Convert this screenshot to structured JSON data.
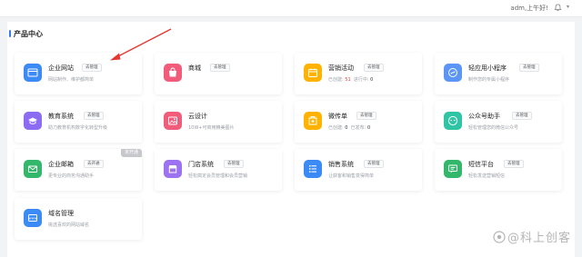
{
  "header": {
    "greeting": "adm,上午好!"
  },
  "section": {
    "title": "产品中心"
  },
  "cards": [
    {
      "title": "企业网站",
      "action": "去管理",
      "desc": "网站制作、维护都简单",
      "color": "#3b8af5",
      "icon": "browser-icon"
    },
    {
      "title": "商城",
      "action": "去管理",
      "desc": "",
      "color": "#f25c7b",
      "icon": "shopping-bag-icon"
    },
    {
      "title": "营销活动",
      "action": "去管理",
      "stats": {
        "l1": "已创建:",
        "v1": "51",
        "l2": "进行中:",
        "v2": "0"
      },
      "color": "#ffb300",
      "icon": "calendar-icon"
    },
    {
      "title": "轻应用小程序",
      "action": "去管理",
      "desc": "制作您的专属小程序",
      "color": "#5b95f7",
      "icon": "mini-program-icon"
    },
    {
      "title": "教育系统",
      "action": "去管理",
      "desc": "助力教育机构数字化转型升级",
      "color": "#8c6cf2",
      "icon": "education-icon"
    },
    {
      "title": "云设计",
      "action": "",
      "desc": "10W+可商用精美图片",
      "color": "#f25c7b",
      "icon": "image-icon"
    },
    {
      "title": "微传单",
      "action": "去管理",
      "stats": {
        "l1": "已创建:",
        "v1": "0",
        "l2": "已发布:",
        "v2": "0"
      },
      "color": "#ffb300",
      "icon": "flyer-icon"
    },
    {
      "title": "公众号助手",
      "action": "去管理",
      "desc": "轻松管理您的微信公众号",
      "color": "#2ec4a4",
      "icon": "wechat-icon"
    },
    {
      "title": "企业邮箱",
      "action": "去开通",
      "desc": "更专业的商务沟通助手",
      "color": "#33b86b",
      "icon": "mail-icon",
      "badge": "未开通"
    },
    {
      "title": "门店系统",
      "action": "去管理",
      "desc": "轻松搞定会员管理和会员营销",
      "color": "#9c72f0",
      "icon": "store-icon"
    },
    {
      "title": "销售系统",
      "action": "去管理",
      "desc": "让获客和销售变得简单",
      "color": "#3b8af5",
      "icon": "list-icon"
    },
    {
      "title": "短信平台",
      "action": "去管理",
      "desc": "轻松发送营销短信",
      "color": "#33b86b",
      "icon": "message-icon"
    },
    {
      "title": "域名管理",
      "action": "",
      "desc": "挑选喜欢的网站域名",
      "color": "#3b8af5",
      "icon": "domain-icon"
    }
  ],
  "watermark": {
    "text": "@科上创客"
  }
}
